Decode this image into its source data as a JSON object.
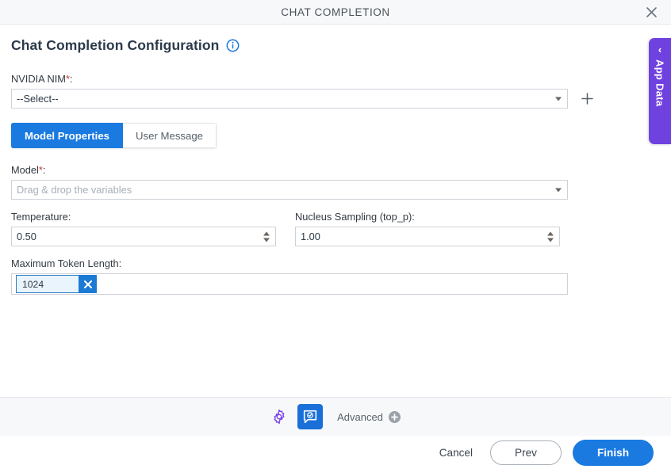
{
  "window": {
    "title": "CHAT COMPLETION",
    "close_icon": "close-icon"
  },
  "side_panel": {
    "label": "App Data",
    "chevron": "‹",
    "color": "#6f42e0"
  },
  "page": {
    "heading": "Chat Completion Configuration",
    "info_icon": "info-icon"
  },
  "form": {
    "nvidia_nim": {
      "label": "NVIDIA NIM",
      "required_mark": "*",
      "colon": ":",
      "value": "--Select--",
      "add_icon": "plus-icon"
    },
    "model": {
      "label": "Model",
      "required_mark": "*",
      "colon": ":",
      "placeholder": "Drag & drop the variables",
      "value": ""
    },
    "temperature": {
      "label": "Temperature:",
      "value": "0.50"
    },
    "nucleus_sampling": {
      "label": "Nucleus Sampling (top_p):",
      "value": "1.00"
    },
    "maximum_token_length": {
      "label": "Maximum Token Length:",
      "chip_value": "1024",
      "remove_icon": "close-icon"
    }
  },
  "tabs": [
    {
      "label": "Model Properties",
      "active": true
    },
    {
      "label": "User Message",
      "active": false
    }
  ],
  "toolbar": {
    "gear_icon": "gear-icon",
    "chat_icon": "chat-check-icon",
    "advanced_label": "Advanced",
    "advanced_add_icon": "plus-circle-icon"
  },
  "footer": {
    "cancel_label": "Cancel",
    "prev_label": "Prev",
    "finish_label": "Finish"
  },
  "colors": {
    "accent_blue": "#1a7ae0",
    "purple": "#6f42e0",
    "required_red": "#c0392b",
    "chip_blue": "#1a7ad4"
  }
}
